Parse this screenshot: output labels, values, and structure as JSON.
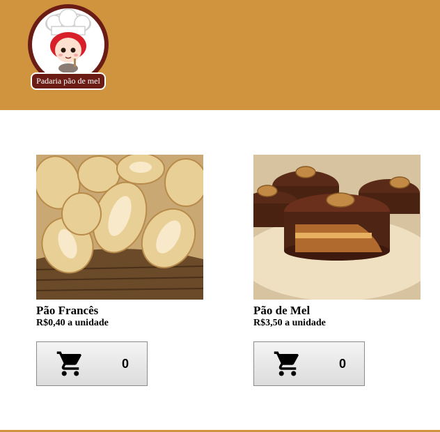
{
  "header": {
    "brand_color": "#d0943e",
    "logo": {
      "label": "Padaria pão de mel",
      "icon": "chef-girl-logo-icon"
    }
  },
  "products": [
    {
      "name": "Pão Francês",
      "price": "R$0,40 a unidade",
      "image": "french-bread-basket-photo",
      "cart_count": "0",
      "cart_icon": "shopping-cart-icon"
    },
    {
      "name": "Pão de Mel",
      "price": "R$3,50 a unidade",
      "image": "chocolate-honey-cake-photo",
      "cart_count": "0",
      "cart_icon": "shopping-cart-icon"
    }
  ]
}
